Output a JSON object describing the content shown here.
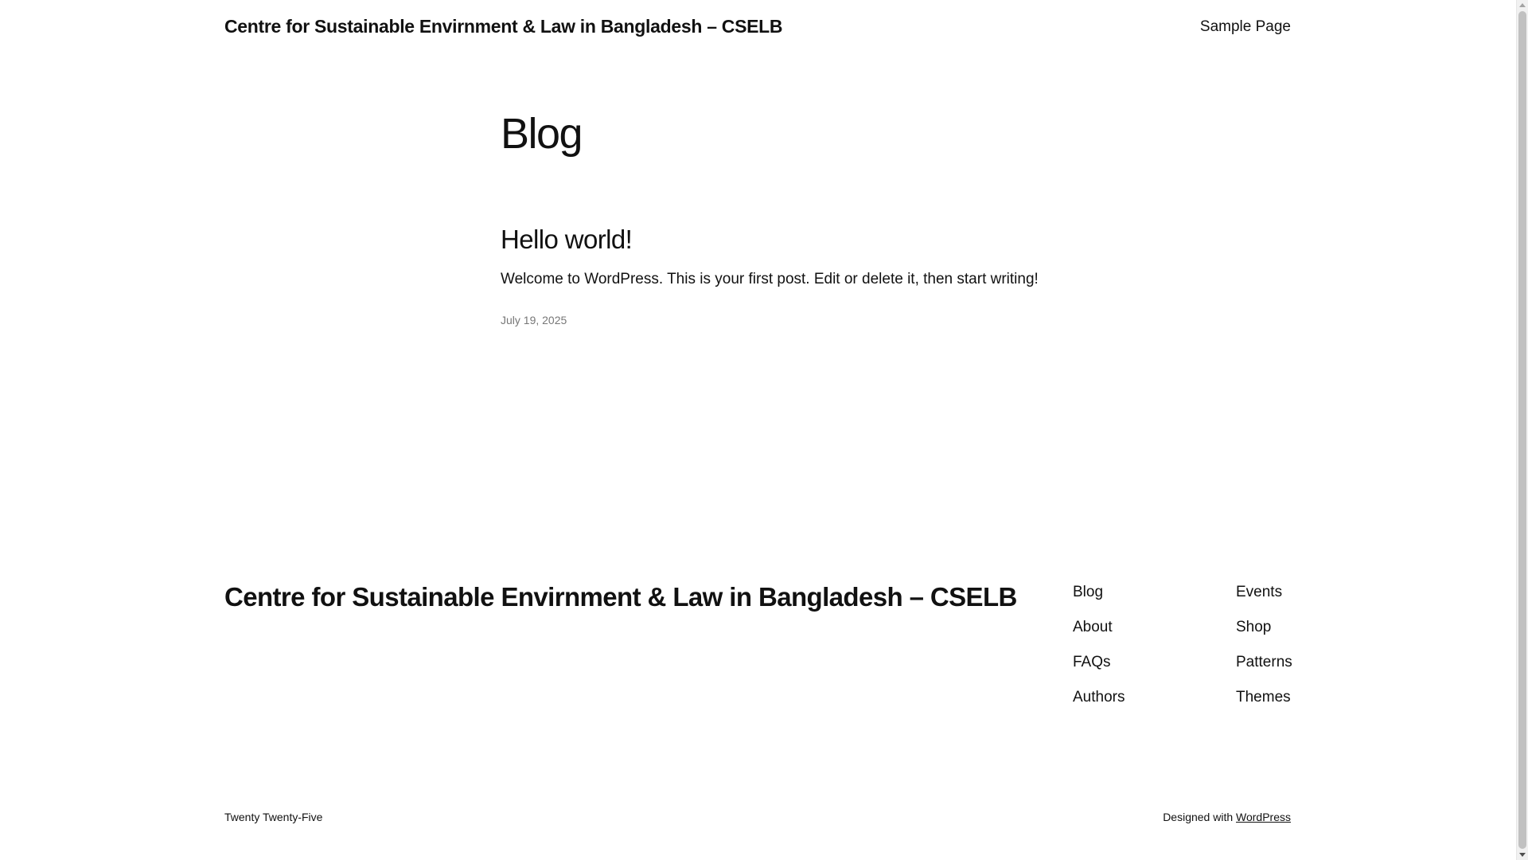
{
  "header": {
    "site_title": "Centre for Sustainable Envirnment & Law in Bangladesh – CSELB",
    "nav": [
      "Sample Page"
    ]
  },
  "main": {
    "heading": "Blog",
    "posts": [
      {
        "title": "Hello world!",
        "excerpt": "Welcome to WordPress. This is your first post. Edit or delete it, then start writing!",
        "date": "July 19, 2025"
      }
    ]
  },
  "footer": {
    "site_title": "Centre for Sustainable Envirnment & Law in Bangladesh – CSELB",
    "col1": [
      "Blog",
      "About",
      "FAQs",
      "Authors"
    ],
    "col2": [
      "Events",
      "Shop",
      "Patterns",
      "Themes"
    ],
    "theme_credit": "Twenty Twenty-Five",
    "designed_with": "Designed with",
    "designed_with_link": "WordPress"
  },
  "colors": {
    "text": "#111111",
    "muted": "#777777",
    "background": "#ffffff"
  }
}
